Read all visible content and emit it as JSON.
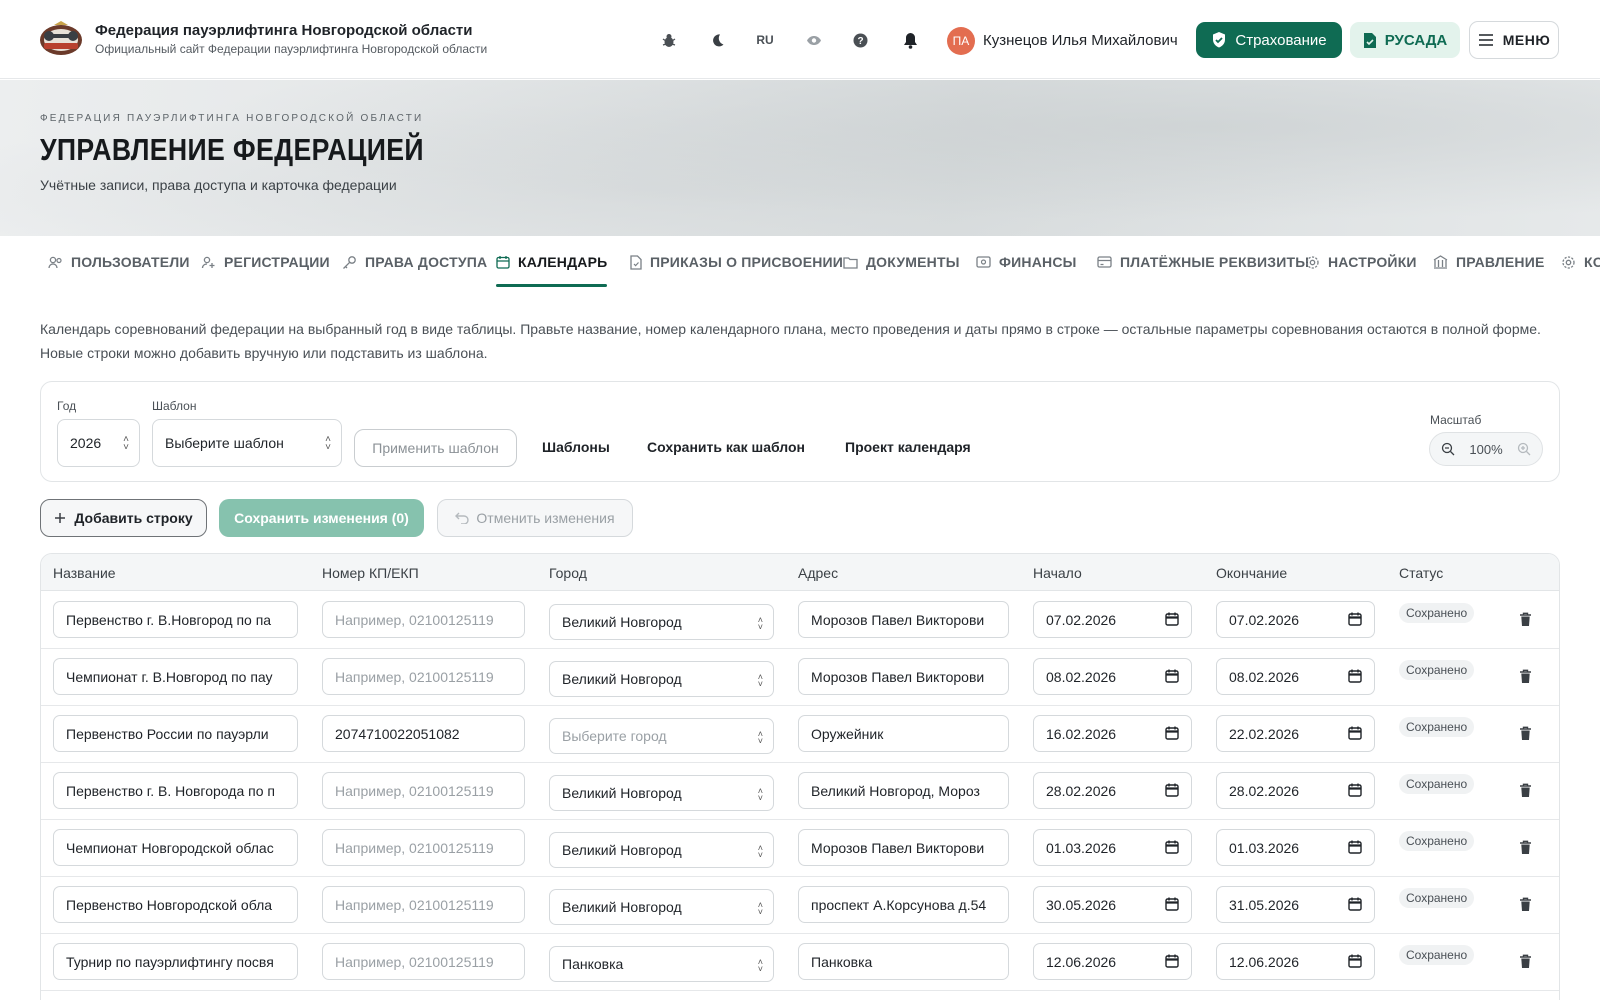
{
  "header": {
    "site_title": "Федерация пауэрлифтинга Новгородской области",
    "site_subtitle": "Официальный сайт Федерации пауэрлифтинга Новгородской области",
    "lang": "RU",
    "user_initials": "ПА",
    "user_name": "Кузнецов Илья Михайлович",
    "insurance_label": "Страхование",
    "rusada_label": "РУСАДА",
    "menu_label": "МЕНЮ"
  },
  "hero": {
    "kicker": "ФЕДЕРАЦИЯ ПАУЭРЛИФТИНГА НОВГОРОДСКОЙ ОБЛАСТИ",
    "title": "УПРАВЛЕНИЕ ФЕДЕРАЦИЕЙ",
    "subtitle": "Учётные записи, права доступа и карточка федерации"
  },
  "tabs": [
    {
      "label": "ПОЛЬЗОВАТЕЛИ",
      "icon": "users-icon"
    },
    {
      "label": "РЕГИСТРАЦИИ",
      "icon": "user-plus-icon"
    },
    {
      "label": "ПРАВА ДОСТУПА",
      "icon": "key-icon"
    },
    {
      "label": "КАЛЕНДАРЬ",
      "icon": "calendar-icon",
      "active": true
    },
    {
      "label": "ПРИКАЗЫ О ПРИСВОЕНИИ",
      "icon": "document-icon"
    },
    {
      "label": "ДОКУМЕНТЫ",
      "icon": "folder-icon"
    },
    {
      "label": "ФИНАНСЫ",
      "icon": "money-icon"
    },
    {
      "label": "ПЛАТЁЖНЫЕ РЕКВИЗИТЫ",
      "icon": "card-icon"
    },
    {
      "label": "НАСТРОЙКИ",
      "icon": "gear-icon"
    },
    {
      "label": "ПРАВЛЕНИЕ",
      "icon": "building-icon"
    },
    {
      "label": "КО",
      "icon": "gear-icon"
    }
  ],
  "description": "Календарь соревнований федерации на выбранный год в виде таблицы. Правьте название, номер календарного плана, место проведения и даты прямо в строке — остальные параметры соревнования остаются в полной форме. Новые строки можно добавить вручную или подставить из шаблона.",
  "filters": {
    "year_label": "Год",
    "year_value": "2026",
    "template_label": "Шаблон",
    "template_placeholder": "Выберите шаблон",
    "apply_template": "Применить шаблон",
    "templates": "Шаблоны",
    "save_as_template": "Сохранить как шаблон",
    "calendar_draft": "Проект календаря",
    "zoom_label": "Масштаб",
    "zoom_value": "100%"
  },
  "actions": {
    "add_row": "Добавить строку",
    "save_changes": "Сохранить изменения (0)",
    "cancel_changes": "Отменить изменения"
  },
  "table": {
    "headers": {
      "name": "Название",
      "number": "Номер КП/ЕКП",
      "city": "Город",
      "address": "Адрес",
      "start": "Начало",
      "end": "Окончание",
      "status": "Статус"
    },
    "number_placeholder": "Например, 02100125119",
    "city_placeholder": "Выберите город",
    "rows": [
      {
        "name": "Первенство г. В.Новгород по па",
        "number": "",
        "city": "Великий Новгород",
        "address": "Морозов Павел Викторови",
        "start": "07.02.2026",
        "end": "07.02.2026",
        "status": "Сохранено"
      },
      {
        "name": "Чемпионат г. В.Новгород по пау",
        "number": "",
        "city": "Великий Новгород",
        "address": "Морозов Павел Викторови",
        "start": "08.02.2026",
        "end": "08.02.2026",
        "status": "Сохранено"
      },
      {
        "name": "Первенство России по пауэрли",
        "number": "2074710022051082",
        "city": "",
        "address": "Оружейник",
        "start": "16.02.2026",
        "end": "22.02.2026",
        "status": "Сохранено"
      },
      {
        "name": "Первенство г. В. Новгорода по п",
        "number": "",
        "city": "Великий Новгород",
        "address": "Великий Новгород, Мороз",
        "start": "28.02.2026",
        "end": "28.02.2026",
        "status": "Сохранено"
      },
      {
        "name": "Чемпионат Новгородской облас",
        "number": "",
        "city": "Великий Новгород",
        "address": "Морозов Павел Викторови",
        "start": "01.03.2026",
        "end": "01.03.2026",
        "status": "Сохранено"
      },
      {
        "name": "Первенство Новгородской обла",
        "number": "",
        "city": "Великий Новгород",
        "address": "проспект А.Корсунова д.54",
        "start": "30.05.2026",
        "end": "31.05.2026",
        "status": "Сохранено"
      },
      {
        "name": "Турнир по пауэрлифтингу посвя",
        "number": "",
        "city": "Панковка",
        "address": "Панковка",
        "start": "12.06.2026",
        "end": "12.06.2026",
        "status": "Сохранено"
      },
      {
        "name": "",
        "number": "",
        "city": "",
        "address": "",
        "start": "",
        "end": "",
        "status": ""
      }
    ]
  },
  "colors": {
    "accent": "#0f6b53",
    "accent_light": "#e3f3ec",
    "save_disabled": "#86c2ae",
    "avatar": "#e36d50"
  }
}
